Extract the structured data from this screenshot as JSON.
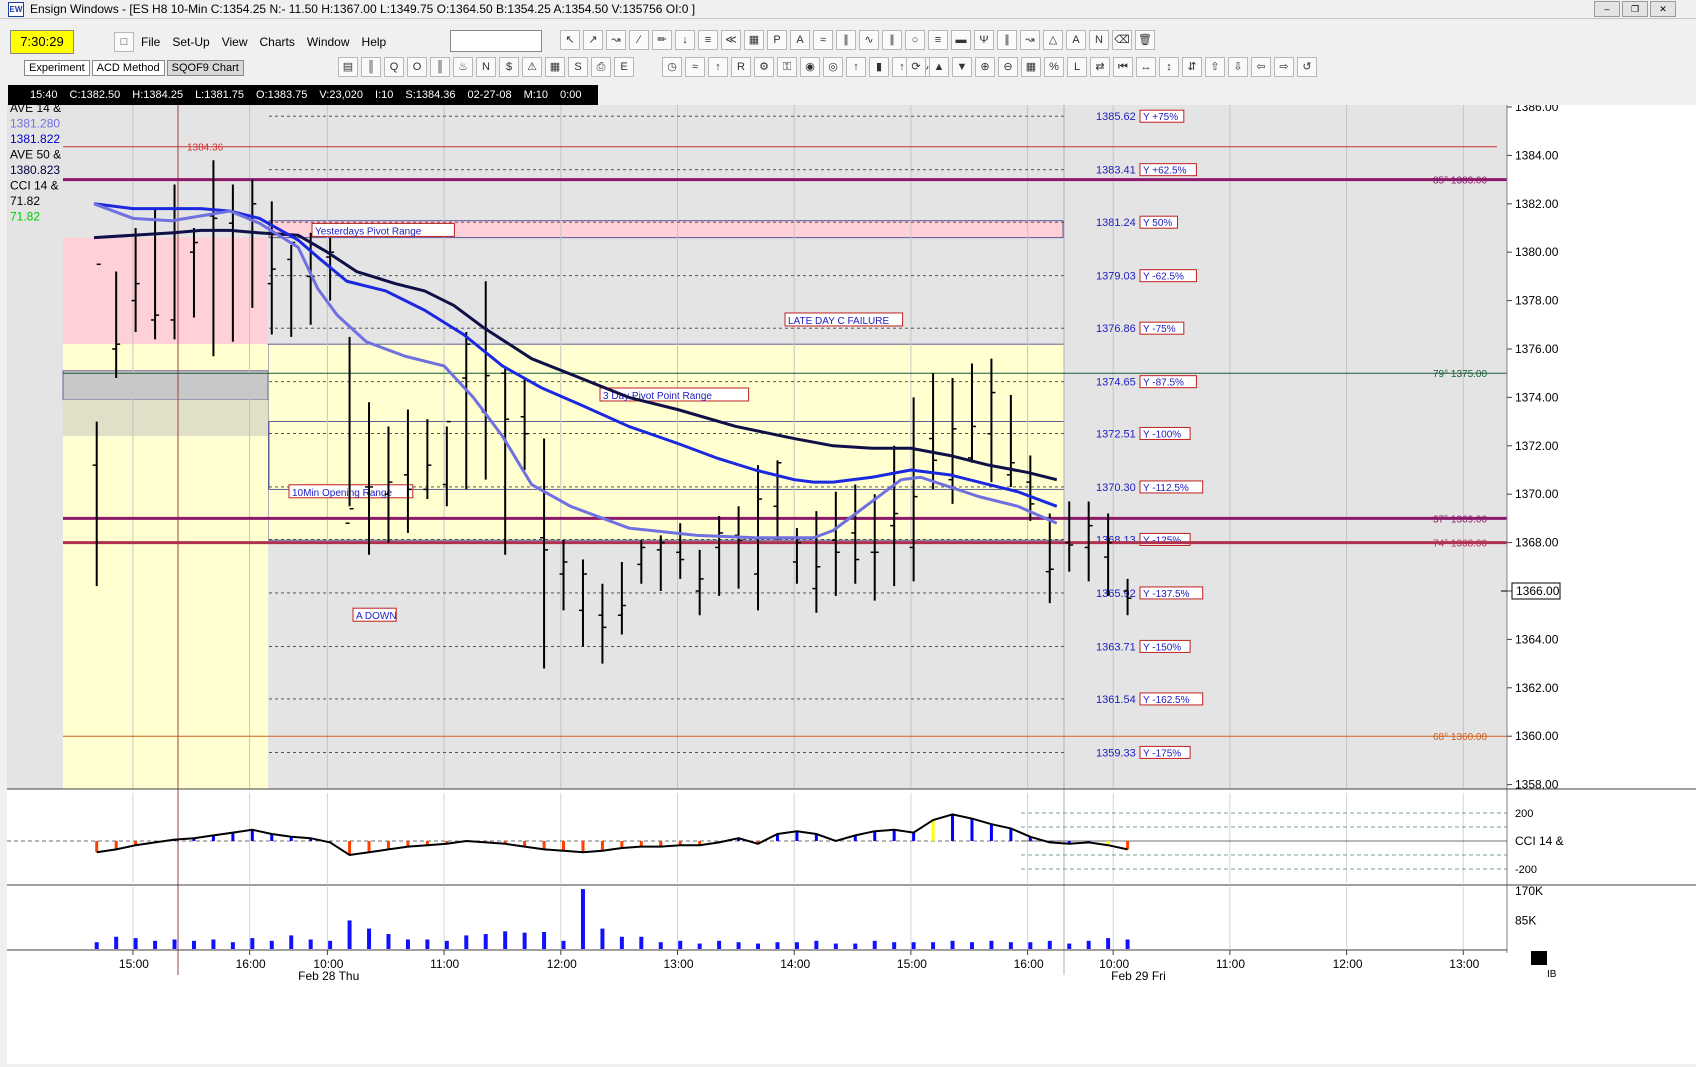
{
  "window": {
    "title": "Ensign Windows - [ES H8 10-Min C:1354.25 N:- 11.50 H:1367.00 L:1349.75 O:1364.50 B:1354.25 A:1354.50 V:135756 OI:0 ]",
    "icon_text": "EW",
    "clock": "7:30:29",
    "menu": [
      "File",
      "Set-Up",
      "View",
      "Charts",
      "Window",
      "Help"
    ]
  },
  "tabs": [
    "Experiment",
    "ACD Method",
    "SQOF9 Chart"
  ],
  "infobar": [
    "15:40",
    "C:1382.50",
    "H:1384.25",
    "L:1381.75",
    "O:1383.75",
    "V:23,020",
    "I:10",
    "S:1384.36",
    "02-27-08",
    "M:10",
    "0:00"
  ],
  "legend": [
    {
      "text": "AVE 14 &",
      "color": "#000000"
    },
    {
      "text": "1381.280",
      "color": "#7070e0"
    },
    {
      "text": "1381.822",
      "color": "#0000cc"
    },
    {
      "text": "AVE 50 &",
      "color": "#000000"
    },
    {
      "text": "1380.823",
      "color": "#000040"
    },
    {
      "text": "CCI 14 &",
      "color": "#000000"
    },
    {
      "text": "71.82",
      "color": "#000000"
    },
    {
      "text": "71.82",
      "color": "#00cc00"
    }
  ],
  "chart_data": {
    "type": "bar",
    "symbol": "ES H8 10-Min",
    "price_axis": {
      "min": 1358,
      "max": 1386,
      "ticks": [
        "1386.00",
        "1384.00",
        "1382.00",
        "1380.00",
        "1378.00",
        "1376.00",
        "1374.00",
        "1372.00",
        "1370.00",
        "1368.00",
        "1366.00",
        "1364.00",
        "1362.00",
        "1360.00",
        "1358.00"
      ],
      "last_price_label": "1366.00",
      "last_price": 1366.0
    },
    "time_axis": {
      "ticks": [
        {
          "label": "15:00",
          "t": 2
        },
        {
          "label": "16:00",
          "t": 8
        },
        {
          "label": "10:00",
          "t": 12
        },
        {
          "label": "11:00",
          "t": 18
        },
        {
          "label": "12:00",
          "t": 24
        },
        {
          "label": "13:00",
          "t": 30
        },
        {
          "label": "14:00",
          "t": 36
        },
        {
          "label": "15:00",
          "t": 42
        },
        {
          "label": "16:00",
          "t": 48
        },
        {
          "label": "10:00",
          "t": 52.4
        },
        {
          "label": "11:00",
          "t": 58.4
        },
        {
          "label": "12:00",
          "t": 64.4
        },
        {
          "label": "13:00",
          "t": 70.4
        }
      ],
      "date_labels": [
        {
          "label": "Feb 28 Thu",
          "t": 10.7
        },
        {
          "label": "Feb 29 Fri",
          "t": 52.5
        }
      ],
      "corner_label": "IB"
    },
    "bars": [
      [
        1373.0,
        1366.2,
        1371.2,
        1379.5
      ],
      [
        1379.2,
        1374.8,
        1376.0,
        1376.2
      ],
      [
        1381.0,
        1376.7,
        1378.0,
        1378.7
      ],
      [
        1381.8,
        1376.4,
        1377.2,
        1377.4
      ],
      [
        1382.8,
        1376.4,
        1377.2,
        1380.8
      ],
      [
        1381.0,
        1377.3,
        1380.0,
        1380.4
      ],
      [
        1383.8,
        1375.7,
        1381.5,
        1381.4
      ],
      [
        1382.8,
        1376.3,
        1381.2,
        1381.6
      ],
      [
        1383.0,
        1377.7,
        1381.5,
        1382.0
      ],
      [
        1382.1,
        1376.6,
        1378.7,
        1379.3
      ],
      [
        1380.3,
        1376.5,
        1379.7,
        1380.4
      ],
      [
        1380.8,
        1377.0,
        1379.0,
        1379.0
      ],
      [
        1380.6,
        1378.0,
        1379.8,
        1380.0
      ],
      [
        1376.5,
        1369.5,
        1368.8,
        1369.4
      ],
      [
        1373.8,
        1367.5,
        1370.3,
        1370.3
      ],
      [
        1372.8,
        1368.0,
        1370.0,
        1370.5
      ],
      [
        1373.5,
        1368.4,
        1370.8,
        1370.2
      ],
      [
        1373.1,
        1369.8,
        1370.2,
        1371.2
      ],
      [
        1372.8,
        1369.5,
        1370.4,
        1373.0
      ],
      [
        1376.7,
        1370.2,
        1374.8,
        1376.2
      ],
      [
        1378.8,
        1370.6,
        1373.4,
        1374.9
      ],
      [
        1375.2,
        1367.5,
        1375.0,
        1373.1
      ],
      [
        1374.8,
        1371.0,
        1373.2,
        1372.5
      ],
      [
        1372.3,
        1362.8,
        1368.2,
        1367.7
      ],
      [
        1368.1,
        1365.2,
        1366.7,
        1367.2
      ],
      [
        1367.3,
        1363.7,
        1365.2,
        1366.7
      ],
      [
        1366.3,
        1363.0,
        1365.0,
        1364.5
      ],
      [
        1367.2,
        1364.2,
        1365.0,
        1365.4
      ],
      [
        1368.1,
        1366.3,
        1367.1,
        1367.8
      ],
      [
        1368.3,
        1366.0,
        1367.7,
        1368.0
      ],
      [
        1368.8,
        1366.5,
        1367.6,
        1367.3
      ],
      [
        1367.7,
        1365.0,
        1366.0,
        1366.5
      ],
      [
        1369.1,
        1365.8,
        1367.8,
        1368.4
      ],
      [
        1369.5,
        1366.1,
        1368.3,
        1368.1
      ],
      [
        1371.2,
        1365.2,
        1366.7,
        1369.8
      ],
      [
        1371.4,
        1368.1,
        1369.5,
        1371.3
      ],
      [
        1368.6,
        1366.3,
        1367.2,
        1368.0
      ],
      [
        1369.3,
        1365.1,
        1366.1,
        1367.0
      ],
      [
        1370.1,
        1365.8,
        1368.1,
        1367.6
      ],
      [
        1370.4,
        1366.3,
        1368.4,
        1367.3
      ],
      [
        1370.0,
        1365.6,
        1367.6,
        1367.6
      ],
      [
        1372.0,
        1366.2,
        1368.7,
        1369.2
      ],
      [
        1374.0,
        1366.4,
        1367.8,
        1369.9
      ],
      [
        1375.0,
        1370.2,
        1372.3,
        1371.4
      ],
      [
        1374.8,
        1369.6,
        1370.6,
        1372.7
      ],
      [
        1375.4,
        1371.3,
        1371.5,
        1372.8
      ],
      [
        1375.6,
        1370.5,
        1372.5,
        1374.2
      ],
      [
        1374.1,
        1370.3,
        1370.8,
        1371.3
      ],
      [
        1371.6,
        1368.9,
        1370.5,
        1369.6
      ],
      [
        1369.2,
        1365.5,
        1366.8,
        1366.9
      ],
      [
        1369.7,
        1366.8,
        1368.0,
        1367.9
      ],
      [
        1369.7,
        1366.4,
        1367.8,
        1368.7
      ],
      [
        1369.2,
        1365.8,
        1367.4,
        1368.0
      ],
      [
        1366.5,
        1365.0,
        1366.0,
        1365.7
      ]
    ],
    "ma_fast": [
      [
        0,
        1382
      ],
      [
        2,
        1381.4
      ],
      [
        4,
        1381.3
      ],
      [
        5.5,
        1381.5
      ],
      [
        7,
        1381.7
      ],
      [
        8.5,
        1381.2
      ],
      [
        10.5,
        1380.2
      ],
      [
        11.5,
        1378.5
      ],
      [
        12.5,
        1377.4
      ],
      [
        14,
        1376.3
      ],
      [
        16,
        1375.7
      ],
      [
        18,
        1375.3
      ],
      [
        19.5,
        1374
      ],
      [
        21,
        1372.4
      ],
      [
        22.5,
        1370.4
      ],
      [
        24.5,
        1369.5
      ],
      [
        27.5,
        1368.6
      ],
      [
        31,
        1368.3
      ],
      [
        34,
        1368.2
      ],
      [
        37,
        1368.2
      ],
      [
        38,
        1368.5
      ],
      [
        40,
        1369.7
      ],
      [
        41.5,
        1370.6
      ],
      [
        42.5,
        1370.7
      ],
      [
        44,
        1370.3
      ],
      [
        45.5,
        1369.9
      ],
      [
        47.5,
        1369.5
      ],
      [
        49.5,
        1368.8
      ]
    ],
    "ma_mid": [
      [
        0,
        1382
      ],
      [
        2,
        1381.8
      ],
      [
        4,
        1381.8
      ],
      [
        5.5,
        1381.8
      ],
      [
        7,
        1381.7
      ],
      [
        8.5,
        1381.4
      ],
      [
        10.5,
        1380.5
      ],
      [
        11.5,
        1379.8
      ],
      [
        13,
        1378.8
      ],
      [
        15,
        1378.4
      ],
      [
        17,
        1377.6
      ],
      [
        19,
        1376.6
      ],
      [
        21,
        1375.3
      ],
      [
        23,
        1374.4
      ],
      [
        25,
        1373.7
      ],
      [
        27.5,
        1372.8
      ],
      [
        30,
        1372.1
      ],
      [
        32,
        1371.5
      ],
      [
        34,
        1371
      ],
      [
        36,
        1370.6
      ],
      [
        37,
        1370.5
      ],
      [
        38,
        1370.5
      ],
      [
        40,
        1370.7
      ],
      [
        42,
        1371
      ],
      [
        44,
        1370.8
      ],
      [
        46,
        1370.4
      ],
      [
        47.5,
        1370.1
      ],
      [
        49.5,
        1369.5
      ]
    ],
    "ma_slow": [
      [
        0,
        1380.6
      ],
      [
        2,
        1380.7
      ],
      [
        4,
        1380.8
      ],
      [
        5.5,
        1380.9
      ],
      [
        7,
        1380.9
      ],
      [
        8.5,
        1380.8
      ],
      [
        10.5,
        1380.7
      ],
      [
        12,
        1380.0
      ],
      [
        13.5,
        1379.2
      ],
      [
        15.5,
        1378.7
      ],
      [
        17,
        1378.4
      ],
      [
        18.5,
        1377.8
      ],
      [
        20,
        1376.9
      ],
      [
        22.5,
        1375.6
      ],
      [
        25,
        1374.8
      ],
      [
        27.5,
        1374.0
      ],
      [
        30,
        1373.5
      ],
      [
        33,
        1372.8
      ],
      [
        36,
        1372.3
      ],
      [
        38,
        1372.0
      ],
      [
        40,
        1371.9
      ],
      [
        42,
        1371.9
      ],
      [
        44,
        1371.6
      ],
      [
        46,
        1371.2
      ],
      [
        48,
        1370.9
      ],
      [
        49.5,
        1370.6
      ]
    ],
    "pivot_lines": [
      {
        "price": 1385.62,
        "label": "1385.62",
        "tag": "Y +75%"
      },
      {
        "price": 1383.41,
        "label": "1383.41",
        "tag": "Y +62.5%"
      },
      {
        "price": 1381.24,
        "label": "1381.24",
        "tag": "Y 50%"
      },
      {
        "price": 1379.03,
        "label": "1379.03",
        "tag": "Y -62.5%"
      },
      {
        "price": 1376.86,
        "label": "1376.86",
        "tag": "Y -75%"
      },
      {
        "price": 1374.65,
        "label": "1374.65",
        "tag": "Y -87.5%"
      },
      {
        "price": 1372.51,
        "label": "1372.51",
        "tag": "Y -100%"
      },
      {
        "price": 1370.3,
        "label": "1370.30",
        "tag": "Y -112.5%"
      },
      {
        "price": 1368.13,
        "label": "1368.13",
        "tag": "Y -125%"
      },
      {
        "price": 1365.92,
        "label": "1365.92",
        "tag": "Y -137.5%"
      },
      {
        "price": 1363.71,
        "label": "1363.71",
        "tag": "Y -150%"
      },
      {
        "price": 1361.54,
        "label": "1361.54",
        "tag": "Y -162.5%"
      },
      {
        "price": 1359.33,
        "label": "1359.33",
        "tag": "Y -175%"
      }
    ],
    "horizontal_levels": [
      {
        "price": 1384.36,
        "label": "1384.36",
        "color": "#cc3333",
        "style": "thin"
      },
      {
        "price": 1383.0,
        "label": "85° 1383.00",
        "color": "#8b1a6b",
        "style": "thick"
      },
      {
        "price": 1375.0,
        "label": "79° 1375.00",
        "color": "#1a5c3a",
        "style": "thin"
      },
      {
        "price": 1369.0,
        "label": "37° 1369.00",
        "color": "#8b1a6b",
        "style": "thick"
      },
      {
        "price": 1368.0,
        "label": "74° 1368.00",
        "color": "#b03050",
        "style": "thick"
      },
      {
        "price": 1360.0,
        "label": "68° 1360.00",
        "color": "#d06020",
        "style": "thin"
      }
    ],
    "annotations": [
      "Yesterdays Pivot Range",
      "LATE DAY C FAILURE",
      "3 Day Pivot Point Range",
      "10Min Opening Range",
      "A DOWN"
    ],
    "zones": [
      {
        "name": "yesterdays-pivot-range",
        "price_low": 1380.6,
        "price_high": 1381.3,
        "color": "#ffd0d8"
      },
      {
        "name": "prior-day-range",
        "price_low": 1376.2,
        "price_high": 1380.6,
        "color": "#ffd0d8"
      },
      {
        "name": "three-day-pivot-range",
        "price_low": 1368.1,
        "price_high": 1376.2,
        "color": "#ffffd0"
      },
      {
        "name": "prior-session-background",
        "price_low": 1358,
        "price_high": 1376.2,
        "color": "#ffffd0"
      }
    ],
    "cci": {
      "levels": [
        "200",
        "-200"
      ],
      "label": "CCI 14 &",
      "range": [
        -300,
        300
      ],
      "values": [
        -80,
        -60,
        -30,
        -10,
        10,
        20,
        40,
        60,
        80,
        50,
        30,
        20,
        -10,
        -100,
        -80,
        -60,
        -40,
        -30,
        -20,
        0,
        -10,
        -20,
        -40,
        -60,
        -70,
        -80,
        -70,
        -50,
        -40,
        -40,
        -30,
        -30,
        -10,
        20,
        -20,
        50,
        70,
        50,
        0,
        40,
        70,
        80,
        60,
        150,
        190,
        160,
        120,
        90,
        30,
        -10,
        -20,
        -10,
        -30,
        -60
      ],
      "bar_colors": [
        "#ff4000",
        "#ff4000",
        "#ff4000",
        "#ff4000",
        "#0000ff",
        "#0000ff",
        "#0000ff",
        "#0000ff",
        "#0000ff",
        "#0000ff",
        "#0000ff",
        "#0000ff",
        "#ff4000",
        "#ff4000",
        "#ff4000",
        "#ff4000",
        "#ff4000",
        "#ff4000",
        "#ff4000",
        "#ff4000",
        "#ff4000",
        "#ff4000",
        "#ff4000",
        "#ff4000",
        "#ff4000",
        "#ff4000",
        "#ff4000",
        "#ff4000",
        "#ff4000",
        "#ff4000",
        "#ff4000",
        "#ff4000",
        "#ff4000",
        "#0000ff",
        "#ff4000",
        "#0000ff",
        "#0000ff",
        "#0000ff",
        "#0000ff",
        "#0000ff",
        "#0000ff",
        "#0000ff",
        "#0000ff",
        "#ffff00",
        "#0000ff",
        "#0000ff",
        "#0000ff",
        "#0000ff",
        "#0000ff",
        "#0000ff",
        "#0000ff",
        "#0000ff",
        "#ffff00",
        "#ff4000"
      ]
    },
    "volume": {
      "ticks": [
        "170K",
        "85K"
      ],
      "values": [
        10,
        18,
        16,
        12,
        14,
        12,
        14,
        10,
        16,
        12,
        20,
        14,
        12,
        42,
        30,
        22,
        14,
        14,
        12,
        20,
        22,
        26,
        24,
        25,
        12,
        88,
        30,
        18,
        18,
        10,
        12,
        8,
        12,
        10,
        8,
        10,
        10,
        12,
        8,
        8,
        12,
        10,
        10,
        10,
        12,
        10,
        12,
        10,
        10,
        12,
        8,
        12,
        16,
        14,
        8,
        10,
        10,
        12,
        14,
        10,
        12,
        16,
        12,
        14,
        12,
        10,
        10,
        12,
        8,
        10,
        6,
        6,
        12,
        12,
        4,
        6
      ]
    }
  }
}
